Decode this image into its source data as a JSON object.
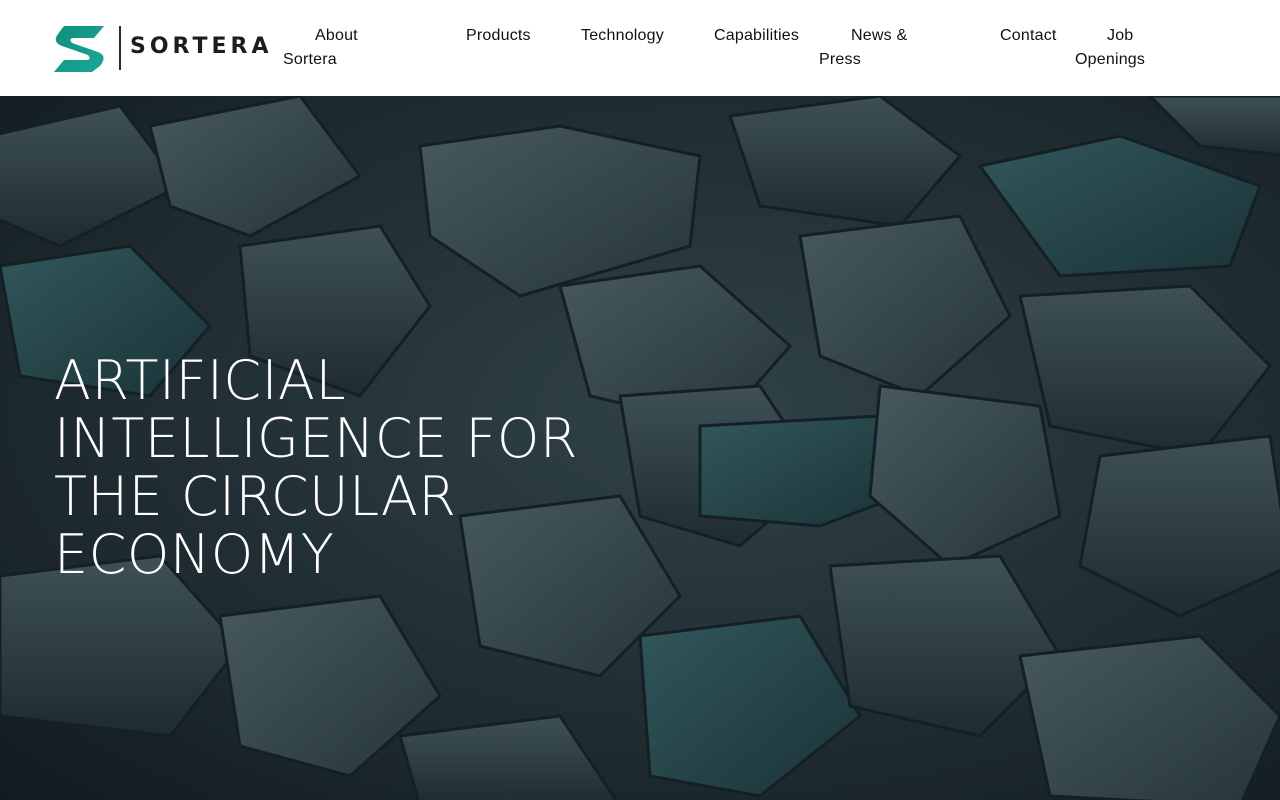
{
  "brand": {
    "name": "SORTERA",
    "logo_icon": "s-monogram-logo",
    "accent_color": "#1a9a8a"
  },
  "nav": {
    "about_line1": "About",
    "about_line2": "Sortera",
    "products": "Products",
    "technology": "Technology",
    "capabilities": "Capabilities",
    "news_line1": "News &",
    "news_line2": "Press",
    "contact": "Contact",
    "jobs_line1": "Job",
    "jobs_line2": "Openings"
  },
  "hero": {
    "headline_lines": [
      "ARTIFICIAL",
      "INTELLIGENCE FOR",
      "THE CIRCULAR",
      "ECONOMY"
    ],
    "background": "scrap-metal-pile-image"
  }
}
